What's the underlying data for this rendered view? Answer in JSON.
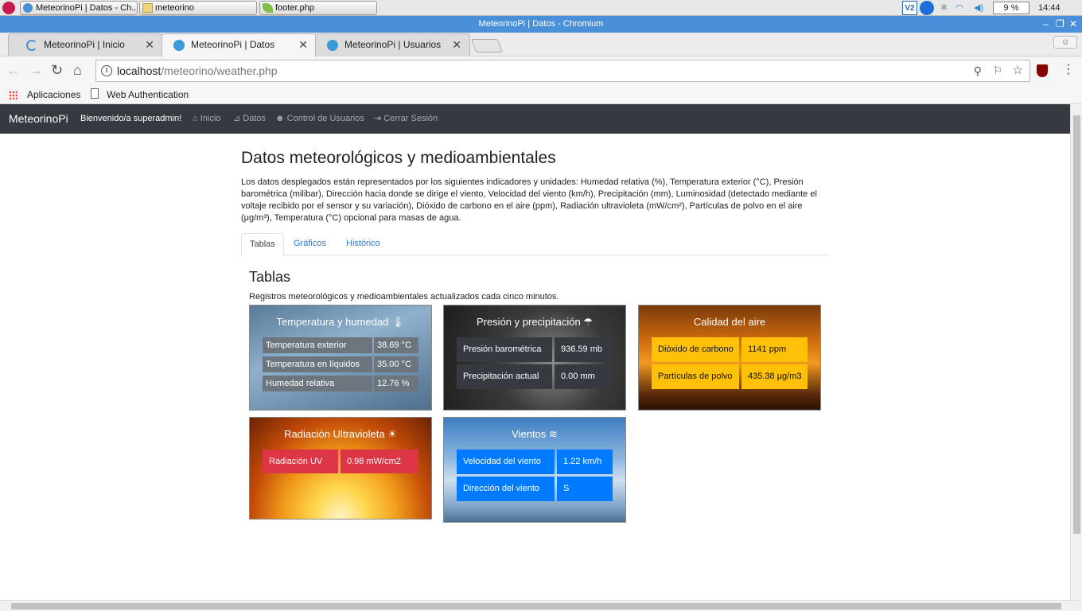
{
  "taskbar": {
    "items": [
      "MeteorinoPi | Datos - Ch...",
      "meteorino",
      "footer.php"
    ],
    "battery": "9 %",
    "clock": "14:44"
  },
  "window": {
    "title": "MeteorinoPi | Datos - Chromium"
  },
  "tabs": [
    {
      "label": "MeteorinoPi | Inicio"
    },
    {
      "label": "MeteorinoPi | Datos"
    },
    {
      "label": "MeteorinoPi | Usuarios"
    }
  ],
  "omnibox": {
    "host": "localhost",
    "path": "/meteorino/weather.php"
  },
  "bookmarks": [
    "Aplicaciones",
    "Web Authentication"
  ],
  "navbar": {
    "brand": "MeteorinoPi",
    "welcome": "Bienvenido/a superadmin!",
    "links": [
      "Inicio",
      "Datos",
      "Control de Usuarios",
      "Cerrar Sesión"
    ]
  },
  "page": {
    "title": "Datos meteorológicos y medioambientales",
    "description": "Los datos desplegados están representados por los siguientes indicadores y unidades: Humedad relativa (%), Temperatura exterior (°C), Presión barométrica (milibar), Dirección hacia donde se dirige el viento, Velocidad del viento (km/h), Precipitación (mm), Luminosidad (detectado mediante el voltaje recibido por el sensor y su variación), Dióxido de carbono en el aire (ppm), Radiación ultravioleta (mW/cm²), Partículas de polvo en el aire (μg/m³), Temperatura (°C) opcional para masas de agua.",
    "tabs": [
      "Tablas",
      "Gráficos",
      "Histórico"
    ],
    "section_title": "Tablas",
    "section_subtitle": "Registros meteorológicos y medioambientales actualizados cada cinco minutos."
  },
  "cards": {
    "temperatura": {
      "title": "Temperatura y humedad",
      "rows": [
        [
          "Temperatura exterior",
          "38.69 °C"
        ],
        [
          "Temperatura en líquidos",
          "35.00 °C"
        ],
        [
          "Humedad relativa",
          "12.76 %"
        ]
      ]
    },
    "presion": {
      "title": "Presión y precipitación",
      "rows": [
        [
          "Presión barométrica",
          "936.59 mb"
        ],
        [
          "Precipitación actual",
          "0.00 mm"
        ]
      ]
    },
    "aire": {
      "title": "Calidad del aire",
      "rows": [
        [
          "Dióxido de carbono",
          "1141 ppm"
        ],
        [
          "Partículas de polvo",
          "435.38 µg/m3"
        ]
      ]
    },
    "uv": {
      "title": "Radiación Ultravioleta",
      "rows": [
        [
          "Radiación UV",
          "0.98 mW/cm2"
        ]
      ]
    },
    "viento": {
      "title": "Vientos",
      "rows": [
        [
          "Velocidad del viento",
          "1.22 km/h"
        ],
        [
          "Dirección del viento",
          "S"
        ]
      ]
    }
  },
  "colors": {
    "navbar": "#343a40",
    "accent": "#2a7bd5",
    "warning": "#ffc107",
    "danger": "#dc3545",
    "primary": "#007bff"
  }
}
